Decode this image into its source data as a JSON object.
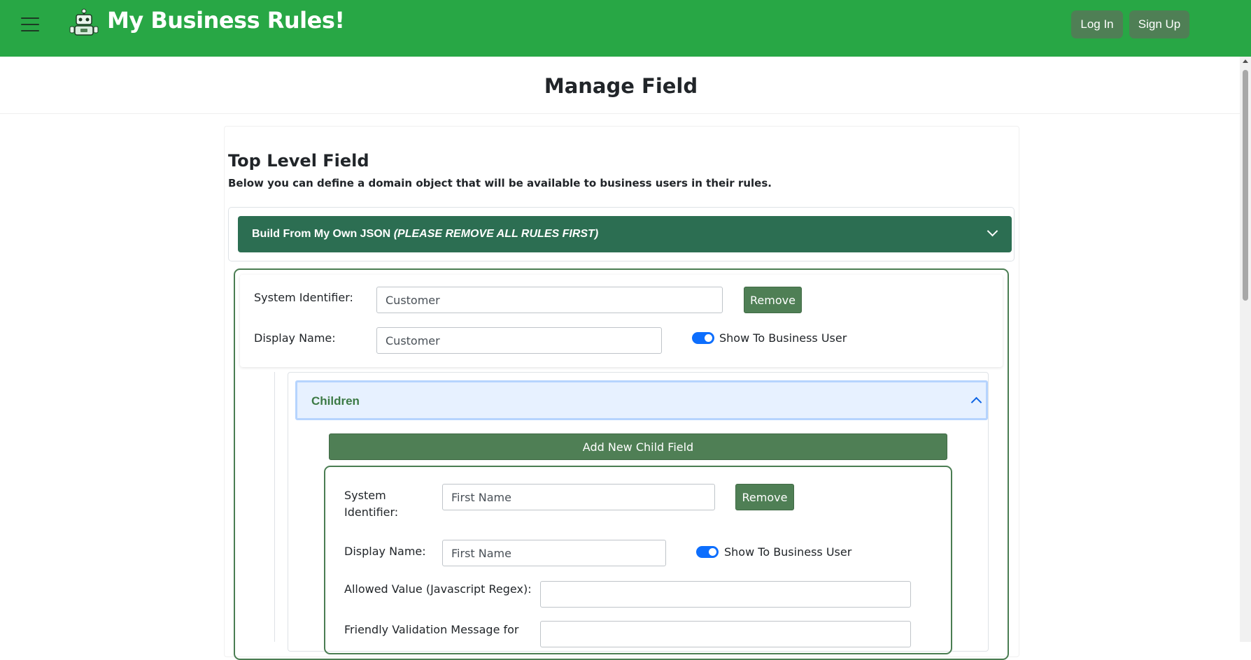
{
  "header": {
    "brand": "My Business Rules!",
    "login_label": "Log In",
    "signup_label": "Sign Up"
  },
  "page": {
    "title": "Manage Field"
  },
  "section": {
    "heading": "Top Level Field",
    "subtitle": "Below you can define a domain object that will be available to business users in their rules."
  },
  "json_accordion": {
    "label": "Build From My Own JSON",
    "warning": "(PLEASE REMOVE ALL RULES FIRST)"
  },
  "field": {
    "system_identifier_label": "System Identifier:",
    "system_identifier_value": "Customer",
    "display_name_label": "Display Name:",
    "display_name_value": "Customer",
    "remove_label": "Remove",
    "show_label": "Show To Business User"
  },
  "children": {
    "heading": "Children",
    "add_label": "Add New Child Field",
    "child": {
      "system_identifier_label_1": "System",
      "system_identifier_label_2": "Identifier:",
      "system_identifier_value": "First Name",
      "display_name_label": "Display Name:",
      "display_name_value": "First Name",
      "remove_label": "Remove",
      "show_label": "Show To Business User",
      "allowed_value_label": "Allowed Value (Javascript Regex):",
      "allowed_value_value": "",
      "friendly_message_label": "Friendly Validation Message for",
      "friendly_message_value": ""
    }
  },
  "colors": {
    "header_bg": "#28a745",
    "accordion_bg": "#2c6e52",
    "button_bg": "#4f7f55",
    "toggle_on": "#0d6efd",
    "children_header_bg": "#e7f1ff"
  }
}
